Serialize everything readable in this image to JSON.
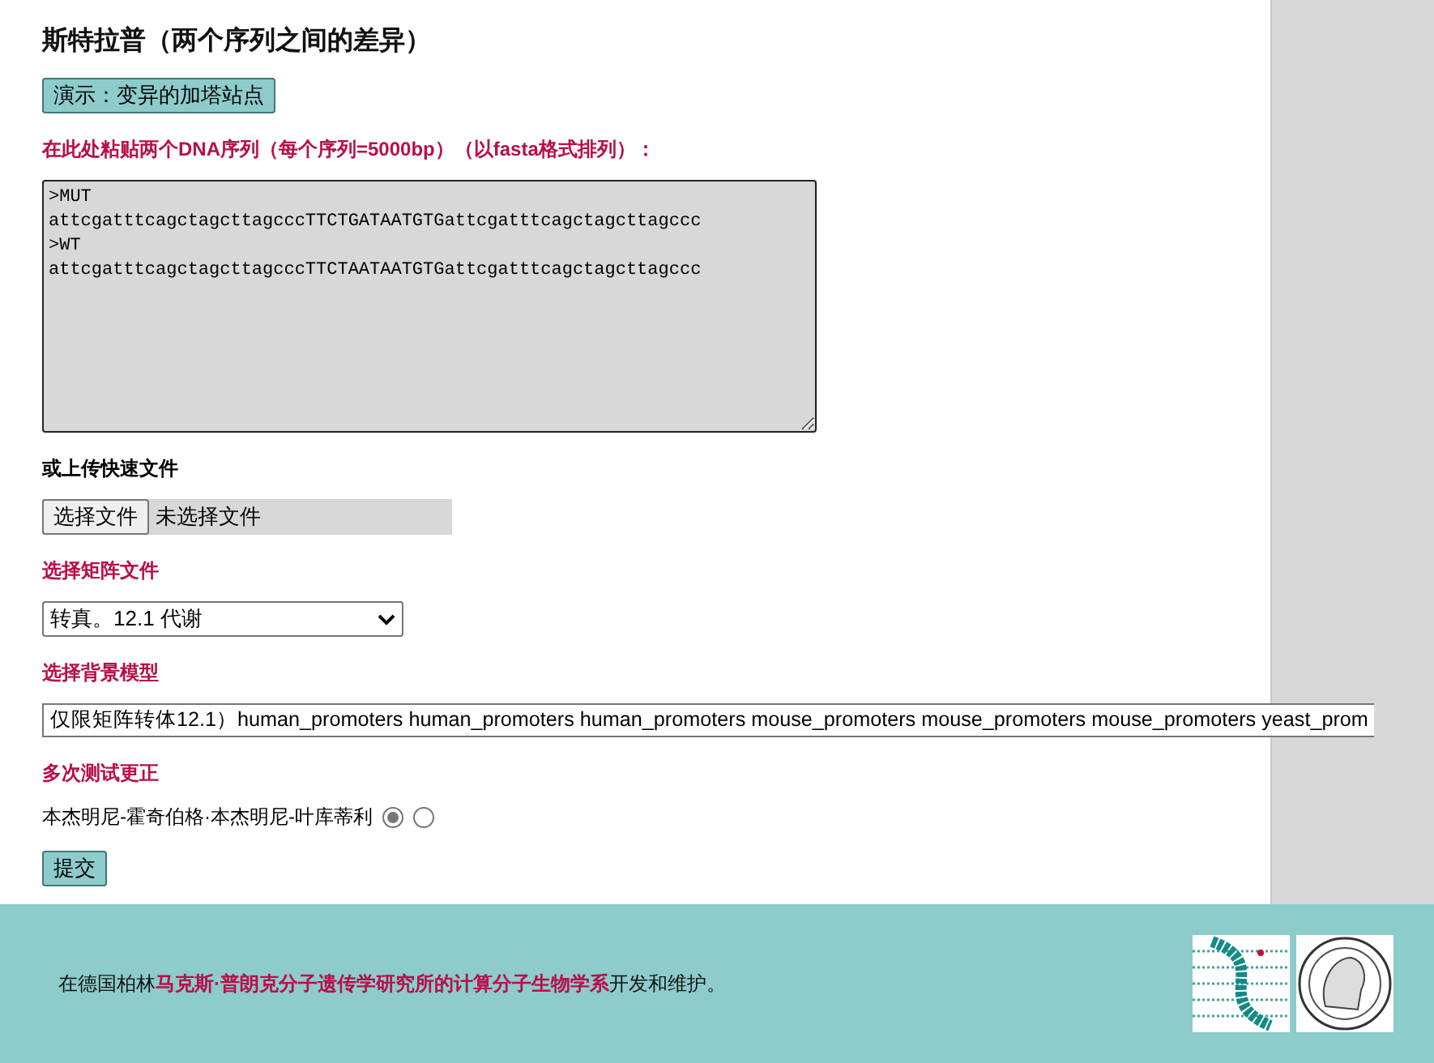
{
  "title": "斯特拉普（两个序列之间的差异）",
  "demo_button": "演示：变异的加塔站点",
  "sequence_label": "在此处粘贴两个DNA序列（每个序列=5000bp）（以fasta格式排列）：",
  "sequence_value": ">MUT\nattcgatttcagctagcttagcccTTCTGATAATGTGattcgatttcagctagcttagccc\n>WT\nattcgatttcagctagcttagcccTTCTAATAATGTGattcgatttcagctagcttagccc",
  "upload": {
    "label": "或上传快速文件",
    "button": "选择文件",
    "status": "未选择文件"
  },
  "matrix": {
    "label": "选择矩阵文件",
    "value": "转真。12.1 代谢"
  },
  "background": {
    "label": "选择背景模型",
    "value": "仅限矩阵转体12.1）human_promoters human_promoters human_promoters mouse_promoters mouse_promoters mouse_promoters yeast_prom"
  },
  "correction": {
    "label": "多次测试更正",
    "option_label": "本杰明尼-霍奇伯格·本杰明尼-叶库蒂利",
    "radios": [
      {
        "selected": true
      },
      {
        "selected": false
      }
    ]
  },
  "submit_button": "提交",
  "footer": {
    "before": "在德国柏林",
    "link": "马克斯·普朗克分子遗传学研究所的计算分子生物学系",
    "after": "开发和维护。"
  }
}
